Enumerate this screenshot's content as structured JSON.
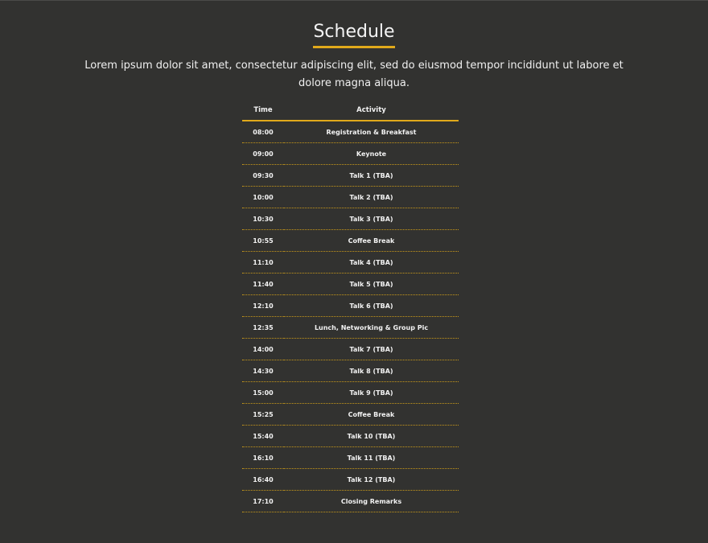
{
  "page": {
    "title": "Schedule",
    "intro": "Lorem ipsum dolor sit amet, consectetur adipiscing elit, sed do eiusmod tempor incididunt ut labore et dolore magna aliqua."
  },
  "colors": {
    "background": "#323230",
    "accent": "#e1a91b",
    "text": "#f2f2f2"
  },
  "table": {
    "headers": {
      "time": "Time",
      "activity": "Activity"
    },
    "rows": [
      {
        "time": "08:00",
        "activity": "Registration & Breakfast"
      },
      {
        "time": "09:00",
        "activity": "Keynote"
      },
      {
        "time": "09:30",
        "activity": "Talk 1 (TBA)"
      },
      {
        "time": "10:00",
        "activity": "Talk 2 (TBA)"
      },
      {
        "time": "10:30",
        "activity": "Talk 3 (TBA)"
      },
      {
        "time": "10:55",
        "activity": "Coffee Break"
      },
      {
        "time": "11:10",
        "activity": "Talk 4 (TBA)"
      },
      {
        "time": "11:40",
        "activity": "Talk 5 (TBA)"
      },
      {
        "time": "12:10",
        "activity": "Talk 6 (TBA)"
      },
      {
        "time": "12:35",
        "activity": "Lunch, Networking & Group Pic"
      },
      {
        "time": "14:00",
        "activity": "Talk 7 (TBA)"
      },
      {
        "time": "14:30",
        "activity": "Talk 8 (TBA)"
      },
      {
        "time": "15:00",
        "activity": "Talk 9 (TBA)"
      },
      {
        "time": "15:25",
        "activity": "Coffee Break"
      },
      {
        "time": "15:40",
        "activity": "Talk 10 (TBA)"
      },
      {
        "time": "16:10",
        "activity": "Talk 11 (TBA)"
      },
      {
        "time": "16:40",
        "activity": "Talk 12 (TBA)"
      },
      {
        "time": "17:10",
        "activity": "Closing Remarks"
      }
    ]
  }
}
